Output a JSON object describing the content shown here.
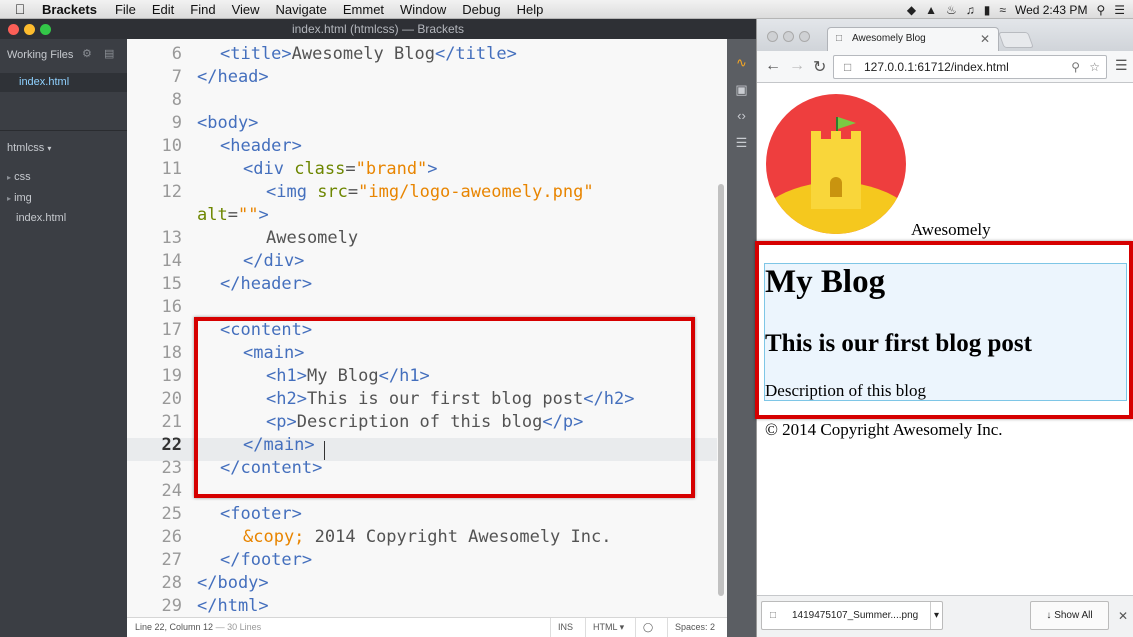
{
  "menubar": {
    "app": "Brackets",
    "items": [
      "File",
      "Edit",
      "Find",
      "View",
      "Navigate",
      "Emmet",
      "Window",
      "Debug",
      "Help"
    ],
    "clock": "Wed 2:43 PM"
  },
  "window_title": "index.html (htmlcss) — Brackets",
  "sidebar": {
    "working_files_label": "Working Files",
    "open_file": "index.html",
    "project": "htmlcss",
    "tree": [
      {
        "label": "css",
        "folder": true
      },
      {
        "label": "img",
        "folder": true
      },
      {
        "label": "index.html",
        "folder": false
      }
    ]
  },
  "editor": {
    "line_numbers": [
      "6",
      "7",
      "8",
      "9",
      "10",
      "11",
      "12",
      "",
      "13",
      "14",
      "15",
      "16",
      "17",
      "18",
      "19",
      "20",
      "21",
      "22",
      "23",
      "24",
      "25",
      "26",
      "27",
      "28",
      "29"
    ],
    "current_line": "22"
  },
  "statusbar": {
    "position": "Line 22, Column 12",
    "lines": "— 30 Lines",
    "mode": "INS",
    "language": "HTML",
    "spaces": "Spaces: 2"
  },
  "browser": {
    "tab_title": "Awesomely Blog",
    "url": "127.0.0.1:61712/index.html",
    "page": {
      "brand": "Awesomely",
      "h1": "My Blog",
      "h2": "This is our first blog post",
      "description": "Description of this blog",
      "footer": "© 2014 Copyright Awesomely Inc."
    },
    "download": {
      "filename": "1419475107_Summer....png",
      "show_all": "Show All"
    }
  },
  "colors": {
    "highlight": "#d60000",
    "tag": "#446fbd",
    "attribute": "#6d8600",
    "value": "#e88501"
  }
}
